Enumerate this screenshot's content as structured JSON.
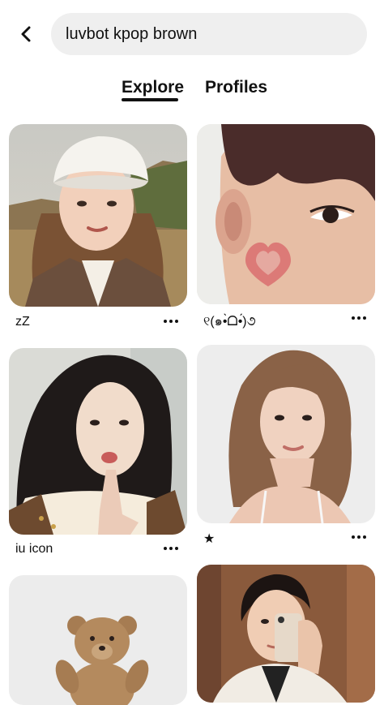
{
  "search": {
    "query": "luvbot kpop brown"
  },
  "tabs": [
    {
      "label": "Explore",
      "active": true
    },
    {
      "label": "Profiles",
      "active": false
    }
  ],
  "pins": [
    {
      "caption": "zZ",
      "image": "girl-white-beret-photo"
    },
    {
      "caption": "୧(๑•̀ᗝ•́)૭",
      "image": "boy-heart-cheek-photo"
    },
    {
      "caption": "iu icon",
      "image": "girl-finger-lips-photo"
    },
    {
      "caption": "★",
      "image": "girl-bangs-portrait-photo"
    },
    {
      "caption": "",
      "image": "teddy-bear-photo"
    },
    {
      "caption": "",
      "image": "boy-mirror-selfie-photo"
    }
  ],
  "colors": {
    "search_bg": "#efefef",
    "text": "#111111",
    "background": "#ffffff"
  },
  "icons": {
    "back": "chevron-left-icon",
    "more": "more-horizontal-icon"
  }
}
